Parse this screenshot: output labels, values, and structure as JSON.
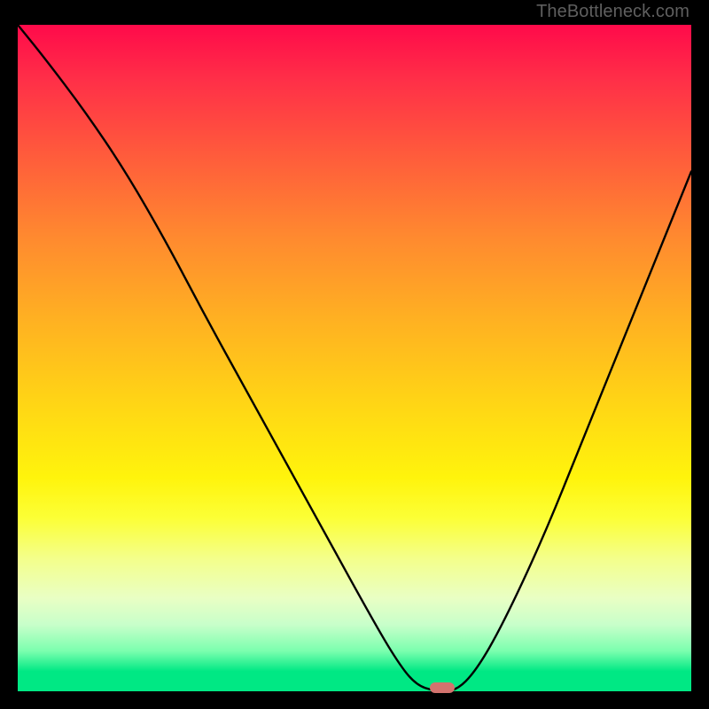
{
  "watermark": "TheBottleneck.com",
  "chart_data": {
    "type": "line",
    "title": "",
    "xlabel": "",
    "ylabel": "",
    "xlim": [
      0,
      100
    ],
    "ylim": [
      0,
      100
    ],
    "grid": false,
    "legend": false,
    "series": [
      {
        "name": "bottleneck-curve",
        "x": [
          0,
          4,
          10,
          16,
          22,
          28,
          34,
          40,
          46,
          52,
          56,
          59,
          62,
          65,
          68,
          72,
          78,
          84,
          90,
          96,
          100
        ],
        "y": [
          100,
          95,
          87,
          78,
          67.5,
          56,
          45,
          34,
          23,
          12,
          5,
          1,
          0,
          0,
          3,
          10,
          23,
          38,
          53,
          68,
          78
        ]
      }
    ],
    "marker": {
      "x": 63,
      "y": 0.5
    },
    "colors": {
      "gradient_top": "#ff0a4a",
      "gradient_mid": "#ffd316",
      "gradient_bottom": "#00e884",
      "curve": "#000000",
      "marker": "#d3736e",
      "frame": "#000000"
    }
  }
}
